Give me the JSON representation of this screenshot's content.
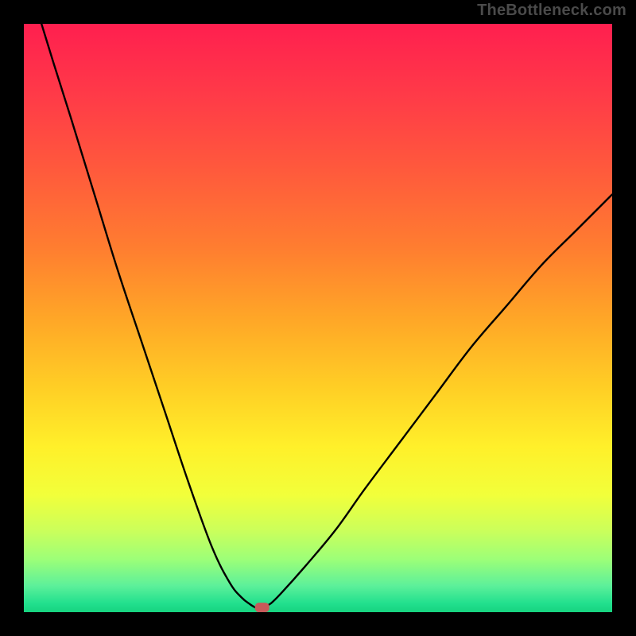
{
  "watermark": "TheBottleneck.com",
  "chart_data": {
    "type": "line",
    "title": "",
    "xlabel": "",
    "ylabel": "",
    "xlim": [
      0,
      100
    ],
    "ylim": [
      0,
      100
    ],
    "grid": false,
    "series": [
      {
        "name": "curve",
        "x": [
          3,
          5,
          8,
          12,
          16,
          20,
          24,
          28,
          32,
          35,
          37,
          38.5,
          39.5,
          40,
          40.5,
          42,
          44,
          48,
          53,
          58,
          64,
          70,
          76,
          82,
          88,
          94,
          100
        ],
        "y": [
          100,
          93.5,
          84,
          71,
          58,
          46,
          34,
          22,
          11,
          5,
          2.5,
          1.3,
          0.7,
          0.5,
          0.8,
          1.5,
          3.5,
          8,
          14,
          21,
          29,
          37,
          45,
          52,
          59,
          65,
          71
        ]
      }
    ],
    "marker": {
      "x": 40.5,
      "y": 0.8
    },
    "background_gradient": {
      "stops": [
        {
          "offset": 0.0,
          "color": "#ff1f4f"
        },
        {
          "offset": 0.12,
          "color": "#ff3a48"
        },
        {
          "offset": 0.25,
          "color": "#ff5a3c"
        },
        {
          "offset": 0.38,
          "color": "#ff7d30"
        },
        {
          "offset": 0.5,
          "color": "#ffa627"
        },
        {
          "offset": 0.62,
          "color": "#ffcf25"
        },
        {
          "offset": 0.72,
          "color": "#fff02a"
        },
        {
          "offset": 0.8,
          "color": "#f2ff3a"
        },
        {
          "offset": 0.86,
          "color": "#ccff5a"
        },
        {
          "offset": 0.91,
          "color": "#9dff78"
        },
        {
          "offset": 0.955,
          "color": "#5df09a"
        },
        {
          "offset": 0.985,
          "color": "#22e08e"
        },
        {
          "offset": 1.0,
          "color": "#17d37f"
        }
      ]
    }
  }
}
